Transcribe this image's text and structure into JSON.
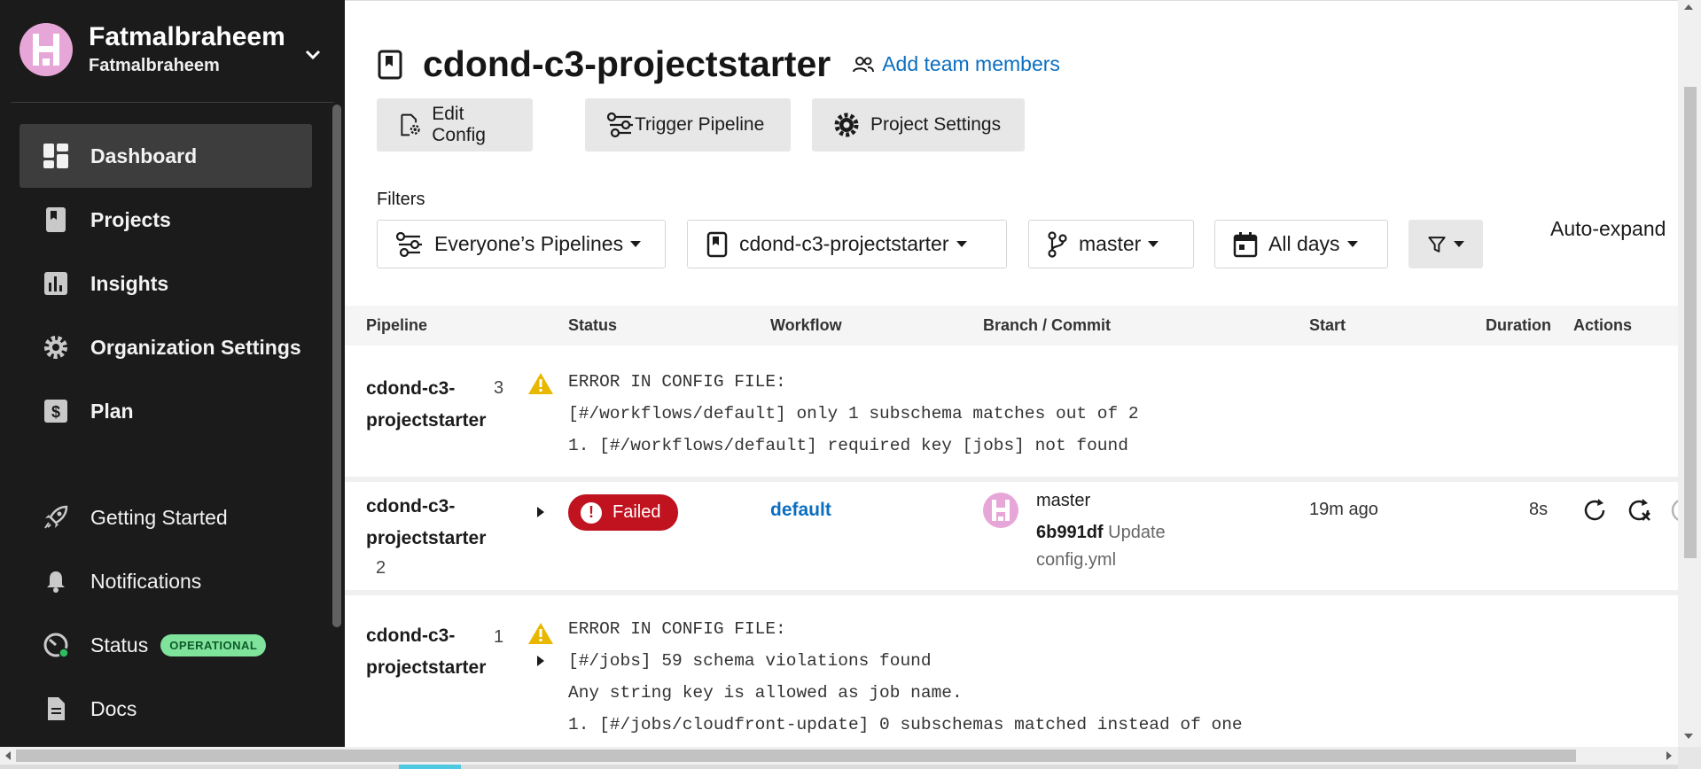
{
  "sidebar": {
    "org_name": "Fatmalbraheem",
    "org_sub": "Fatmalbraheem",
    "items": [
      {
        "label": "Dashboard",
        "icon": "dashboard-icon"
      },
      {
        "label": "Projects",
        "icon": "projects-icon"
      },
      {
        "label": "Insights",
        "icon": "insights-icon"
      },
      {
        "label": "Organization Settings",
        "icon": "gear-icon"
      },
      {
        "label": "Plan",
        "icon": "dollar-icon"
      },
      {
        "label": "Getting Started",
        "icon": "rocket-icon"
      },
      {
        "label": "Notifications",
        "icon": "bell-icon"
      },
      {
        "label": "Status",
        "icon": "gauge-icon"
      },
      {
        "label": "Docs",
        "icon": "doc-icon"
      }
    ],
    "status_badge": "OPERATIONAL"
  },
  "header": {
    "project_title": "cdond-c3-projectstarter",
    "add_team": "Add team members"
  },
  "toolbar": {
    "edit_config": "Edit Config",
    "trigger_pipeline": "Trigger Pipeline",
    "project_settings": "Project Settings"
  },
  "filters": {
    "label": "Filters",
    "pipelines": "Everyone’s Pipelines",
    "project": "cdond-c3-projectstarter",
    "branch": "master",
    "days": "All days",
    "auto_expand": "Auto-expand"
  },
  "table": {
    "headers": [
      "Pipeline",
      "Status",
      "Workflow",
      "Branch / Commit",
      "Start",
      "Duration",
      "Actions"
    ],
    "rows": [
      {
        "name_line1": "cdond-c3-",
        "name_line2": "projectstarter",
        "number": "3",
        "error_lines": [
          "ERROR IN CONFIG FILE:",
          "[#/workflows/default] only 1 subschema matches out of 2",
          "1. [#/workflows/default] required key [jobs] not found"
        ]
      },
      {
        "name_line1": "cdond-c3-",
        "name_line2": "projectstarter",
        "number": "2",
        "status": "Failed",
        "workflow": "default",
        "branch": "master",
        "commit_hash": "6b991df",
        "commit_msg_1": "Update",
        "commit_msg_2": "config.yml",
        "start": "19m ago",
        "duration": "8s"
      },
      {
        "name_line1": "cdond-c3-",
        "name_line2": "projectstarter",
        "number": "1",
        "error_lines": [
          "ERROR IN CONFIG FILE:",
          "[#/jobs] 59 schema violations found",
          "Any string key is allowed as job name.",
          "1. [#/jobs/cloudfront-update] 0 subschemas matched instead of one"
        ]
      }
    ]
  },
  "colors": {
    "sidebar_bg": "#1b1b1b",
    "link": "#0b6ec0",
    "failed": "#c0121f",
    "warning": "#e8b800",
    "operational": "#7fe39c"
  }
}
